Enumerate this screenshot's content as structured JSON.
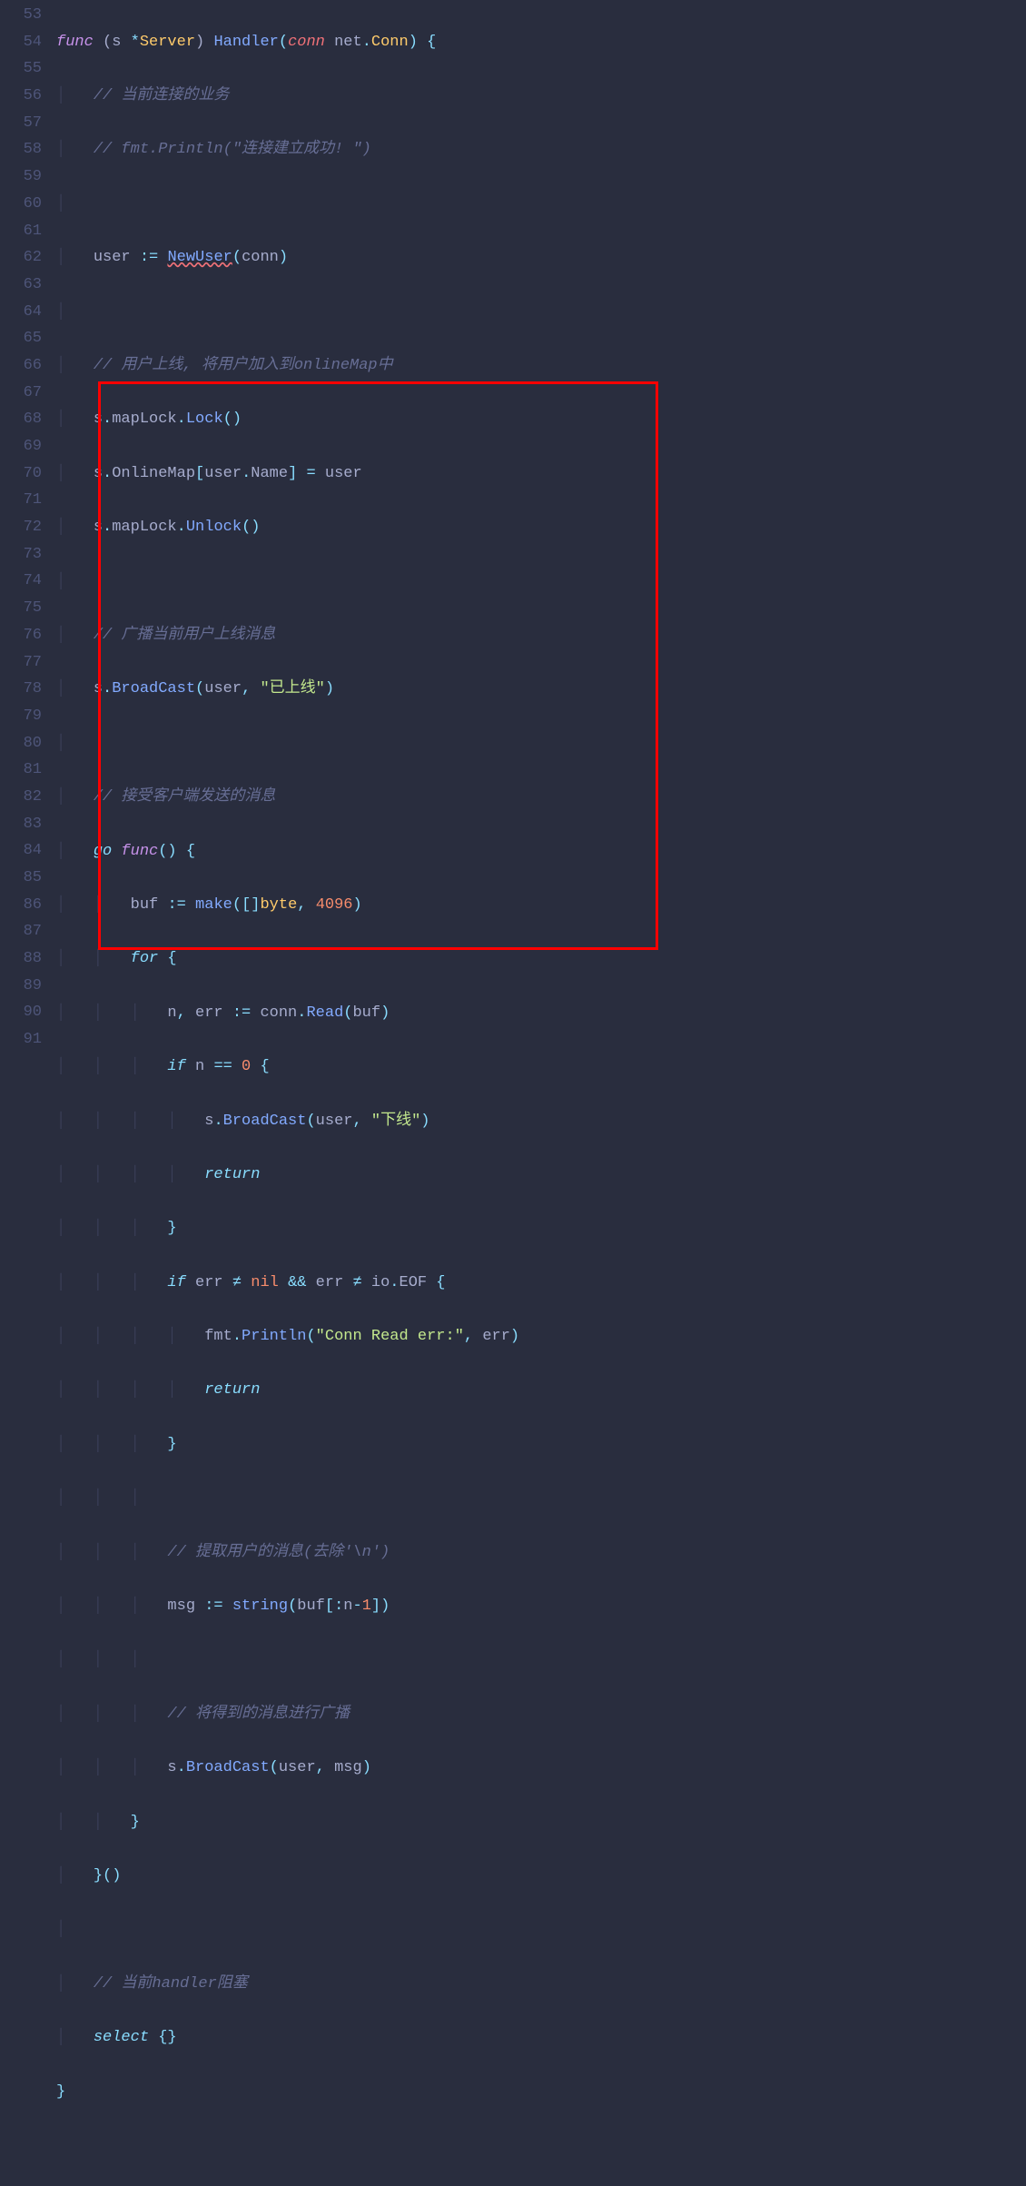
{
  "lines": {
    "first": 53,
    "count": 39
  },
  "code": {
    "l53": {
      "t1": "func",
      "t2": "(s ",
      "t3": "*",
      "t4": "Server",
      "t5": ") ",
      "t6": "Handler",
      "t7": "(",
      "t8": "conn",
      "t9": " net",
      "t10": ".",
      "t11": "Conn",
      "t12": ") {"
    },
    "l54": {
      "c": "// 当前连接的业务"
    },
    "l55": {
      "c": "// fmt.Println(\"连接建立成功! \")"
    },
    "l57": {
      "a": "user ",
      "op": ":=",
      "b": " ",
      "fn": "NewUser",
      "p1": "(",
      "arg": "conn",
      "p2": ")"
    },
    "l59": {
      "c": "// 用户上线, 将用户加入到onlineMap中"
    },
    "l60": {
      "a": "s",
      "d": ".",
      "b": "mapLock",
      "d2": ".",
      "fn": "Lock",
      "p": "()"
    },
    "l61": {
      "a": "s",
      "d": ".",
      "b": "OnlineMap",
      "br1": "[",
      "c": "user",
      "d2": ".",
      "e": "Name",
      "br2": "]",
      "eq": " = ",
      "f": "user"
    },
    "l62": {
      "a": "s",
      "d": ".",
      "b": "mapLock",
      "d2": ".",
      "fn": "Unlock",
      "p": "()"
    },
    "l64": {
      "c": "// 广播当前用户上线消息"
    },
    "l65": {
      "a": "s",
      "d": ".",
      "fn": "BroadCast",
      "p1": "(",
      "arg1": "user",
      "cm": ", ",
      "str": "\"已上线\"",
      "p2": ")"
    },
    "l67": {
      "c": "// 接受客户端发送的消息"
    },
    "l68": {
      "kw": "go ",
      "fn": "func",
      "p": "() {"
    },
    "l69": {
      "a": "buf ",
      "op": ":=",
      "sp": " ",
      "fn": "make",
      "p1": "(",
      "br": "[]",
      "ty": "byte",
      "cm": ", ",
      "nu": "4096",
      "p2": ")"
    },
    "l70": {
      "kw": "for",
      "b": " {"
    },
    "l71": {
      "a": "n",
      "cm": ", ",
      "b": "err ",
      "op": ":=",
      "sp": " ",
      "c": "conn",
      "d": ".",
      "fn": "Read",
      "p1": "(",
      "arg": "buf",
      "p2": ")"
    },
    "l72": {
      "kw": "if",
      "sp": " ",
      "a": "n ",
      "op": "==",
      "sp2": " ",
      "nu": "0",
      "b": " {"
    },
    "l73": {
      "a": "s",
      "d": ".",
      "fn": "BroadCast",
      "p1": "(",
      "arg": "user",
      "cm": ", ",
      "str": "\"下线\"",
      "p2": ")"
    },
    "l74": {
      "kw": "return"
    },
    "l75": {
      "b": "}"
    },
    "l76": {
      "kw": "if",
      "sp": " ",
      "a": "err ",
      "op": "≠",
      "sp2": " ",
      "nil": "nil",
      "sp3": " ",
      "and": "&&",
      "sp4": " ",
      "b": "err ",
      "op2": "≠",
      "sp5": " ",
      "c": "io",
      "d": ".",
      "e": "EOF",
      "f": " {"
    },
    "l77": {
      "a": "fmt",
      "d": ".",
      "fn": "Println",
      "p1": "(",
      "str": "\"Conn Read err:\"",
      "cm": ", ",
      "arg": "err",
      "p2": ")"
    },
    "l78": {
      "kw": "return"
    },
    "l79": {
      "b": "}"
    },
    "l81": {
      "c": "// 提取用户的消息(去除'\\n')"
    },
    "l82": {
      "a": "msg ",
      "op": ":=",
      "sp": " ",
      "fn": "string",
      "p1": "(",
      "arg": "buf",
      "br1": "[:",
      "b": "n",
      "op2": "-",
      "nu": "1",
      "br2": "]",
      "p2": ")"
    },
    "l84": {
      "c": "// 将得到的消息进行广播"
    },
    "l85": {
      "a": "s",
      "d": ".",
      "fn": "BroadCast",
      "p1": "(",
      "arg1": "user",
      "cm": ", ",
      "arg2": "msg",
      "p2": ")"
    },
    "l86": {
      "b": "}"
    },
    "l87": {
      "b": "}()"
    },
    "l89": {
      "c": "// 当前handler阻塞"
    },
    "l90": {
      "kw": "select",
      "b": " {}"
    },
    "l91": {
      "b": "}"
    }
  }
}
